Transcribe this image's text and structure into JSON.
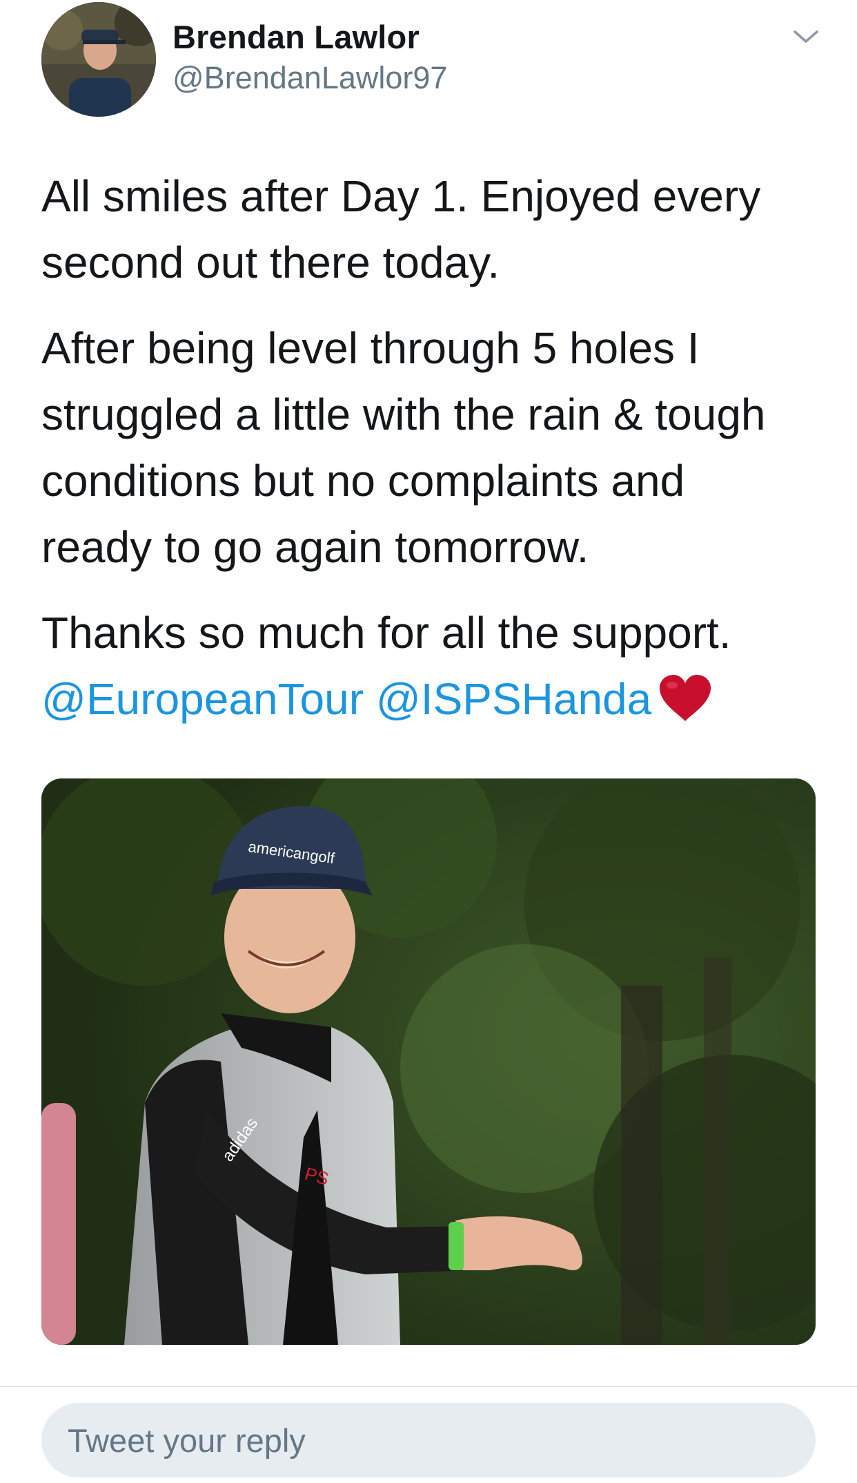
{
  "author": {
    "display_name": "Brendan Lawlor",
    "handle": "@BrendanLawlor97"
  },
  "tweet": {
    "paragraphs": [
      [
        "All smiles after Day 1. Enjoyed every",
        "second out there today."
      ],
      [
        "After being level through 5 holes I",
        "struggled a little with the rain & tough",
        "conditions but no complaints and",
        "ready to go again tomorrow."
      ]
    ],
    "thanks_line": "Thanks so much for all the support.",
    "mentions": [
      "@EuropeanTour",
      "@ISPSHanda"
    ],
    "emoji": "red-heart"
  },
  "media": {
    "cap_text": "americangolf",
    "jacket_brand": "adidas"
  },
  "reply": {
    "placeholder": "Tweet your reply"
  },
  "colors": {
    "text": "#14171a",
    "secondary": "#657786",
    "link": "#1b95e0",
    "reply_bg": "#e6ecf0",
    "divider": "#e1e8ed",
    "heart": "#c8102e"
  }
}
